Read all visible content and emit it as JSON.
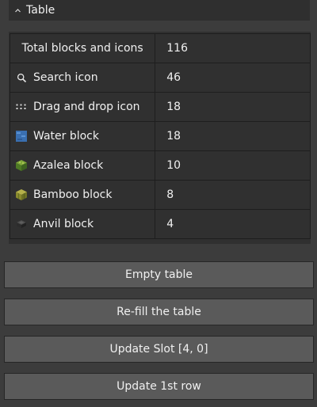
{
  "header": {
    "title": "Table",
    "chevron_icon": "chevron-up-icon"
  },
  "table": {
    "rows": [
      {
        "label": "Total blocks and icons",
        "value": "116",
        "icon": null
      },
      {
        "label": "Search icon",
        "value": "46",
        "icon": "search-icon"
      },
      {
        "label": "Drag and drop icon",
        "value": "18",
        "icon": "drag-handle-icon"
      },
      {
        "label": "Water block",
        "value": "18",
        "icon": "water-block-icon"
      },
      {
        "label": "Azalea block",
        "value": "10",
        "icon": "azalea-block-icon"
      },
      {
        "label": "Bamboo block",
        "value": "8",
        "icon": "bamboo-block-icon"
      },
      {
        "label": "Anvil block",
        "value": "4",
        "icon": "anvil-block-icon"
      }
    ]
  },
  "buttons": {
    "empty": "Empty table",
    "refill": "Re-fill the table",
    "update_slot": "Update Slot [4, 0]",
    "update_row": "Update 1st row"
  },
  "colors": {
    "background": "#3c3c3c",
    "header_bg": "#2f2f2f",
    "table_bg": "#303030",
    "button_bg": "#5a5a5a",
    "text": "#f0f0f0"
  }
}
